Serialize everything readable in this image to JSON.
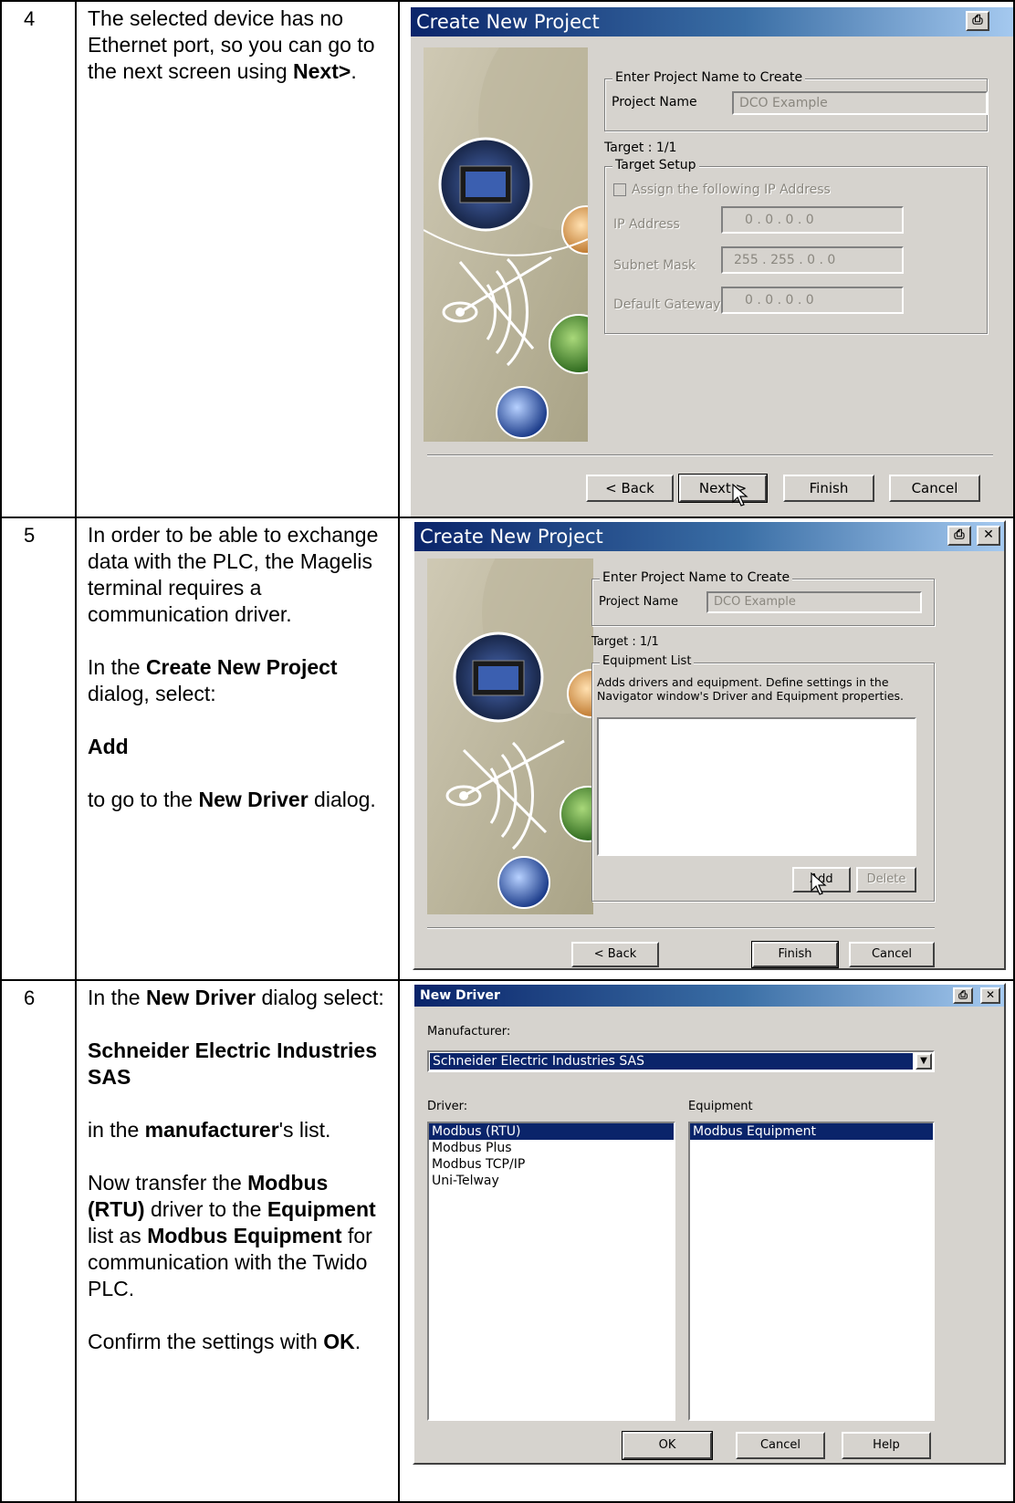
{
  "rows": [
    {
      "num": "4",
      "desc": [
        [
          {
            "t": "The selected device has no Ethernet port, so you can go to the next screen using "
          },
          {
            "t": "Next>",
            "b": true
          },
          {
            "t": "."
          }
        ]
      ],
      "dialog": {
        "title": "Create New Project",
        "print_icon": "printer-icon",
        "project_group": "Enter Project Name to Create",
        "project_name_label": "Project Name",
        "project_name_value": "DCO Example",
        "target": "Target : 1/1",
        "target_setup": "Target Setup",
        "assign_ip": "Assign the following IP Address",
        "ip_label": "IP Address",
        "ip_value": "0 . 0 . 0 . 0",
        "subnet_label": "Subnet Mask",
        "subnet_value": "255 . 255 . 0 . 0",
        "gateway_label": "Default Gateway",
        "gateway_value": "0 . 0 . 0 . 0",
        "back": "< Back",
        "next": "Next >",
        "finish": "Finish",
        "cancel": "Cancel"
      }
    },
    {
      "num": "5",
      "desc": [
        [
          {
            "t": "In order to be able to exchange data with the PLC, the Magelis terminal requires a communication driver."
          }
        ],
        [
          {
            "t": "In the "
          },
          {
            "t": "Create New Project",
            "b": true
          },
          {
            "t": " dialog, select:"
          }
        ],
        [
          {
            "t": "Add",
            "b": true
          }
        ],
        [
          {
            "t": "to go to the "
          },
          {
            "t": "New Driver",
            "b": true
          },
          {
            "t": " dialog."
          }
        ]
      ],
      "dialog": {
        "title": "Create New Project",
        "print_icon": "printer-icon",
        "close": "✕",
        "project_group": "Enter Project Name to Create",
        "project_name_label": "Project Name",
        "project_name_value": "DCO Example",
        "target": "Target : 1/1",
        "equipment_group": "Equipment List",
        "equipment_help": "Adds drivers and equipment. Define settings in the Navigator window's Driver and Equipment properties.",
        "add": "Add",
        "delete": "Delete",
        "back": "< Back",
        "finish": "Finish",
        "cancel": "Cancel"
      }
    },
    {
      "num": "6",
      "desc": [
        [
          {
            "t": "In the "
          },
          {
            "t": "New Driver",
            "b": true
          },
          {
            "t": " dialog select:"
          }
        ],
        [
          {
            "t": "Schneider Electric Industries SAS",
            "b": true
          }
        ],
        [
          {
            "t": "in the "
          },
          {
            "t": "manufacturer",
            "b": true
          },
          {
            "t": "'s  list."
          }
        ],
        [
          {
            "t": "Now transfer the "
          },
          {
            "t": "Modbus (RTU)",
            "b": true
          },
          {
            "t": " driver to the "
          },
          {
            "t": "Equipment",
            "b": true
          },
          {
            "t": " list as "
          },
          {
            "t": "Modbus Equipment",
            "b": true
          },
          {
            "t": " for communication with the Twido PLC."
          }
        ],
        [
          {
            "t": "Confirm the settings with "
          },
          {
            "t": "OK",
            "b": true
          },
          {
            "t": "."
          }
        ]
      ],
      "dialog": {
        "title": "New Driver",
        "print_icon": "printer-icon",
        "close": "✕",
        "manufacturer_label": "Manufacturer:",
        "manufacturer_value": "Schneider Electric Industries SAS",
        "driver_label": "Driver:",
        "equipment_label": "Equipment",
        "drivers": [
          "Modbus (RTU)",
          "Modbus Plus",
          "Modbus TCP/IP",
          "Uni-Telway"
        ],
        "equipment": [
          "Modbus Equipment"
        ],
        "ok": "OK",
        "cancel": "Cancel",
        "help": "Help"
      }
    }
  ]
}
